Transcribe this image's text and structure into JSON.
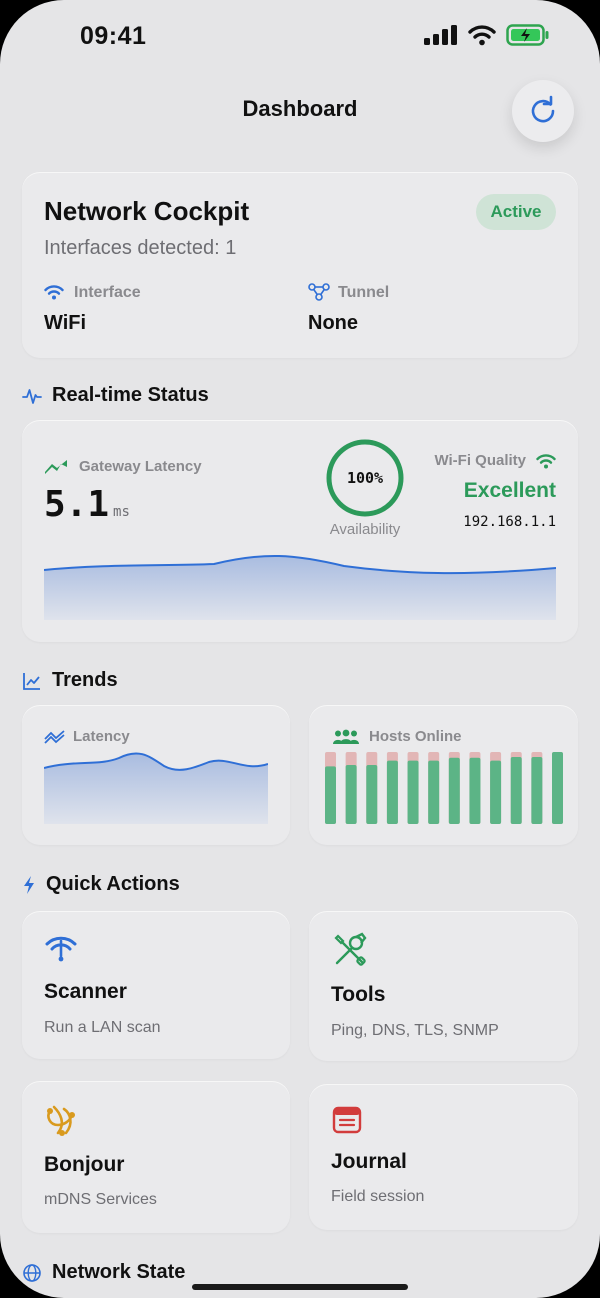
{
  "status_bar": {
    "time": "09:41"
  },
  "nav": {
    "title": "Dashboard"
  },
  "cockpit": {
    "title": "Network Cockpit",
    "badge": "Active",
    "subtitle": "Interfaces detected: 1",
    "interface_label": "Interface",
    "interface_value": "WiFi",
    "tunnel_label": "Tunnel",
    "tunnel_value": "None"
  },
  "realtime": {
    "section_title": "Real-time Status",
    "latency_label": "Gateway Latency",
    "latency_value": "5.1",
    "latency_unit": "ms",
    "availability_value": "100%",
    "availability_fraction": 1.0,
    "availability_label": "Availability",
    "wifi_label": "Wi-Fi Quality",
    "wifi_quality": "Excellent",
    "ip": "192.168.1.1"
  },
  "trends": {
    "section_title": "Trends",
    "latency_label": "Latency",
    "hosts_label": "Hosts Online",
    "hosts_bars": [
      {
        "online": 0.8,
        "total": 1.0
      },
      {
        "online": 0.82,
        "total": 1.0
      },
      {
        "online": 0.82,
        "total": 1.0
      },
      {
        "online": 0.88,
        "total": 1.0
      },
      {
        "online": 0.88,
        "total": 1.0
      },
      {
        "online": 0.88,
        "total": 1.0
      },
      {
        "online": 0.92,
        "total": 1.0
      },
      {
        "online": 0.92,
        "total": 1.0
      },
      {
        "online": 0.88,
        "total": 1.0
      },
      {
        "online": 0.93,
        "total": 1.0
      },
      {
        "online": 0.93,
        "total": 1.0
      },
      {
        "online": 1.0,
        "total": 1.0
      }
    ]
  },
  "quick_actions": {
    "section_title": "Quick Actions",
    "scanner_title": "Scanner",
    "scanner_sub": "Run a LAN scan",
    "tools_title": "Tools",
    "tools_sub": "Ping, DNS, TLS, SNMP",
    "bonjour_title": "Bonjour",
    "bonjour_sub": "mDNS Services",
    "journal_title": "Journal",
    "journal_sub": "Field session"
  },
  "network_state": {
    "section_title": "Network State"
  },
  "colors": {
    "accent": "#2f6fd6",
    "green": "#2c9a5a",
    "bar_green": "#5cb486",
    "bar_red": "#e2b6b6",
    "orange": "#d99a1e",
    "red": "#d23c3c"
  }
}
